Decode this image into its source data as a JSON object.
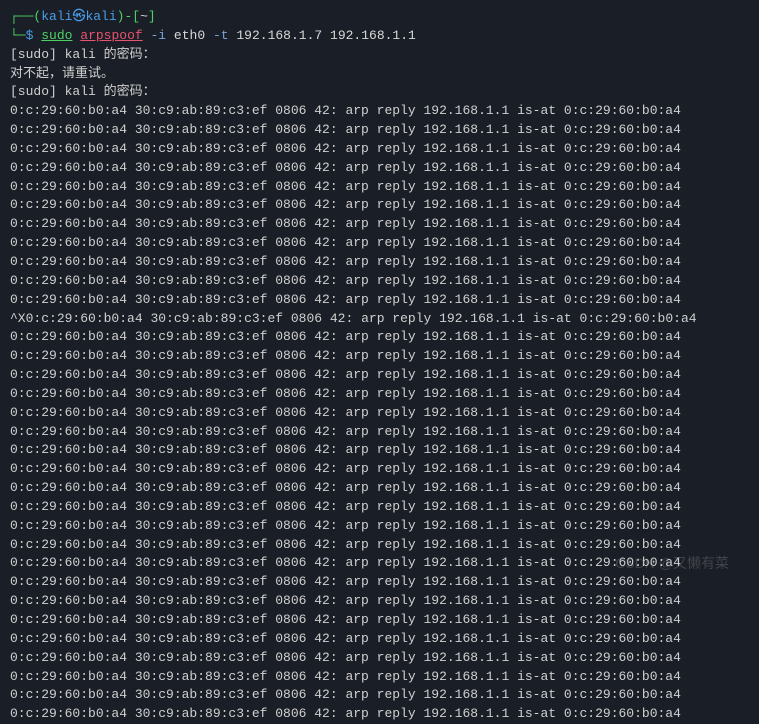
{
  "prompt": {
    "line1_prefix": "┌──(",
    "user": "kali",
    "separator": "㉿",
    "host": "kali",
    "line1_suffix": ")-[",
    "path": "~",
    "line1_close": "]",
    "line2_prefix": "└─",
    "dollar": "$",
    "cmd_sudo": "sudo",
    "cmd_name": "arpspoof",
    "flag_i": "-i",
    "arg_iface": "eth0",
    "flag_t": "-t",
    "arg_target": "192.168.1.7",
    "arg_gateway": "192.168.1.1"
  },
  "sudo_lines": {
    "line1": "[sudo] kali 的密码：",
    "line2": "对不起，请重试。",
    "line3": "[sudo] kali 的密码："
  },
  "arp": {
    "src_mac": "0:c:29:60:b0:a4",
    "dst_mac": "30:c9:ab:89:c3:ef",
    "proto": "0806",
    "len": "42:",
    "msg": "arp reply",
    "ip": "192.168.1.1",
    "isat": "is-at",
    "target_mac": "0:c:29:60:b0:a4"
  },
  "break_prefix": "^X",
  "break_suffix": " 0806 42: arp reply 192.168.1.1 is-at 0:c:29:60:b0:a4",
  "watermark": "CSDN @又懒有菜"
}
